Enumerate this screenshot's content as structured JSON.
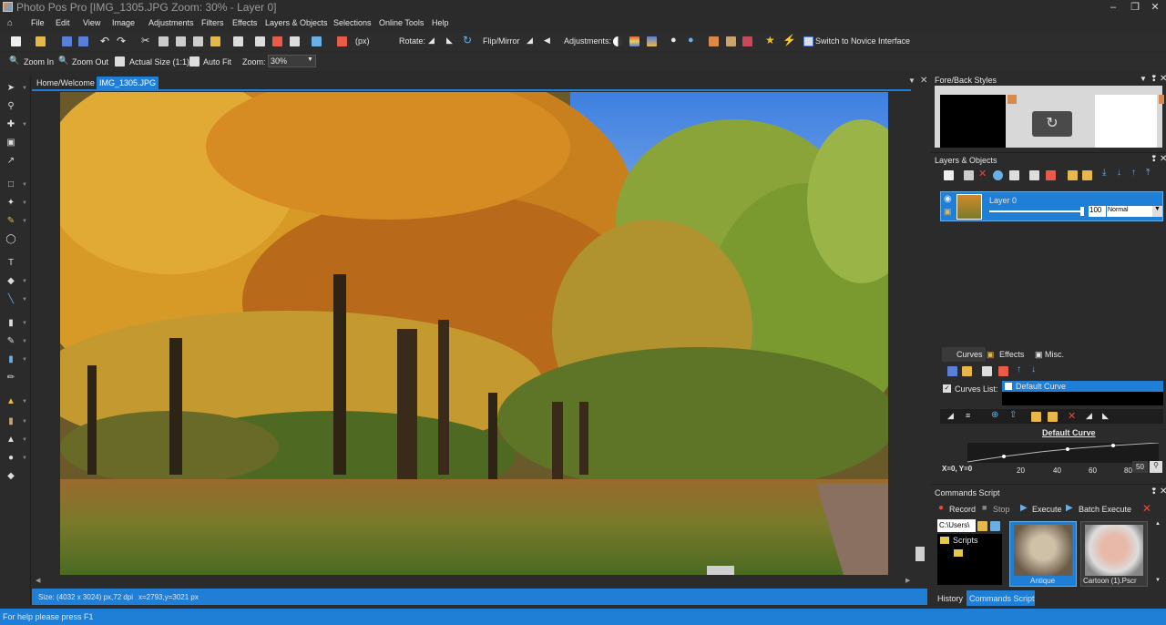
{
  "titlebar": {
    "title": "Photo Pos Pro [IMG_1305.JPG Zoom: 30% - Layer 0]"
  },
  "menu": [
    "File",
    "Edit",
    "View",
    "Image",
    "Adjustments",
    "Filters",
    "Effects",
    "Layers & Objects",
    "Selections",
    "Online Tools",
    "Help"
  ],
  "toolbar1": {
    "unit": "(px)",
    "rotate_label": "Rotate:",
    "flip_label": "Flip/Mirror",
    "adjust_label": "Adjustments:",
    "novice_label": "Switch to Novice Interface"
  },
  "toolbar2": {
    "zoom_in": "Zoom In",
    "zoom_out": "Zoom Out",
    "actual_size": "Actual Size (1:1)",
    "auto_fit": "Auto Fit",
    "zoom_label": "Zoom:",
    "zoom_value": "30%"
  },
  "tabs": {
    "home": "Home/Welcome",
    "image": "IMG_1305.JPG"
  },
  "status": {
    "size": "Size: (4032 x 3024) px,72 dpi",
    "coords": "x=2793,y=3021 px"
  },
  "help": "For help please press F1",
  "panels": {
    "foreback": "Fore/Back Styles",
    "layers": {
      "title": "Layers & Objects",
      "layer_name": "Layer 0",
      "opacity": "100",
      "blend": "Normal"
    },
    "curves_tabs": [
      "Curves",
      "Effects",
      "Misc."
    ],
    "curves": {
      "list_label": "Curves List:",
      "item": "Default Curve",
      "name": "Default Curve",
      "xy": "X=0, Y=0",
      "axis": [
        "20",
        "40",
        "60",
        "80"
      ],
      "value": "50"
    },
    "commands": {
      "title": "Commands Script",
      "record": "Record",
      "stop": "Stop",
      "execute": "Execute",
      "batch": "Batch Execute",
      "path": "C:\\Users\\",
      "folder": "Scripts",
      "thumb1": "Antique",
      "thumb2": "Cartoon (1).Pscr"
    },
    "bottom_tabs": [
      "History",
      "Commands Script"
    ]
  },
  "colors": {
    "accent": "#1f7fd6",
    "bg": "#2b2b2b"
  }
}
